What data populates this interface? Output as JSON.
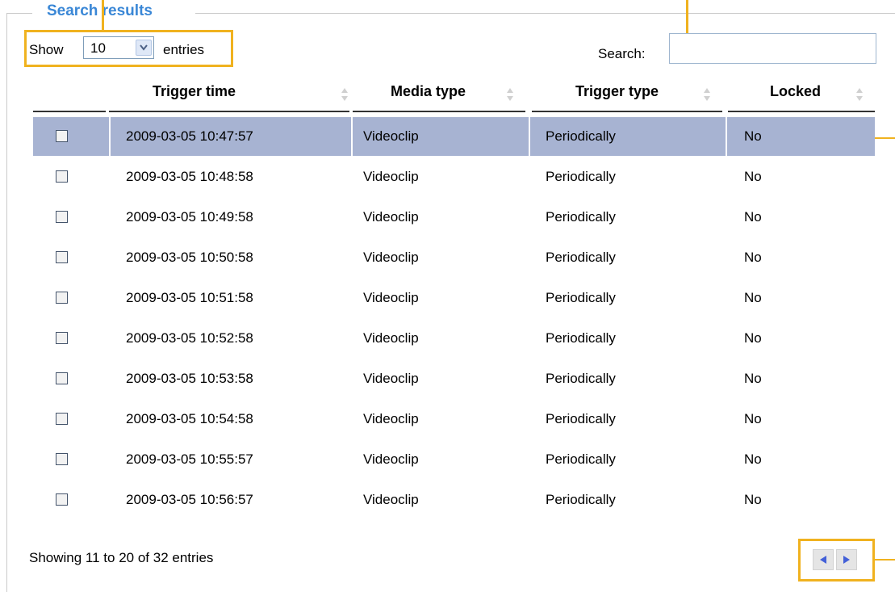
{
  "fieldset": {
    "legend": "Search results"
  },
  "length_control": {
    "prefix": "Show",
    "value": "10",
    "suffix": "entries"
  },
  "search": {
    "label": "Search:",
    "value": "",
    "placeholder": ""
  },
  "table": {
    "columns": [
      {
        "label": "Trigger time"
      },
      {
        "label": "Media type"
      },
      {
        "label": "Trigger type"
      },
      {
        "label": "Locked"
      }
    ],
    "rows": [
      {
        "time": "2009-03-05 10:47:57",
        "media": "Videoclip",
        "trigger": "Periodically",
        "locked": "No",
        "selected": true
      },
      {
        "time": "2009-03-05 10:48:58",
        "media": "Videoclip",
        "trigger": "Periodically",
        "locked": "No"
      },
      {
        "time": "2009-03-05 10:49:58",
        "media": "Videoclip",
        "trigger": "Periodically",
        "locked": "No"
      },
      {
        "time": "2009-03-05 10:50:58",
        "media": "Videoclip",
        "trigger": "Periodically",
        "locked": "No"
      },
      {
        "time": "2009-03-05 10:51:58",
        "media": "Videoclip",
        "trigger": "Periodically",
        "locked": "No"
      },
      {
        "time": "2009-03-05 10:52:58",
        "media": "Videoclip",
        "trigger": "Periodically",
        "locked": "No"
      },
      {
        "time": "2009-03-05 10:53:58",
        "media": "Videoclip",
        "trigger": "Periodically",
        "locked": "No"
      },
      {
        "time": "2009-03-05 10:54:58",
        "media": "Videoclip",
        "trigger": "Periodically",
        "locked": "No"
      },
      {
        "time": "2009-03-05 10:55:57",
        "media": "Videoclip",
        "trigger": "Periodically",
        "locked": "No"
      },
      {
        "time": "2009-03-05 10:56:57",
        "media": "Videoclip",
        "trigger": "Periodically",
        "locked": "No"
      }
    ]
  },
  "info": "Showing 11 to 20 of 32 entries",
  "pager": {
    "prev_icon": "triangle-left-icon",
    "next_icon": "triangle-right-icon"
  },
  "colors": {
    "legend": "#3a87d6",
    "callout": "#f0b21f",
    "selected_row": "#a7b3d2"
  }
}
